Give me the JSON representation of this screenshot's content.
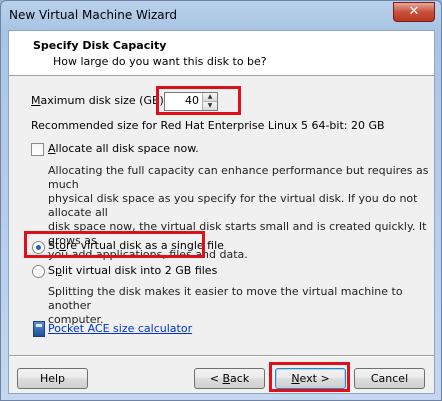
{
  "window": {
    "title": "New Virtual Machine Wizard",
    "close_glyph": "✕"
  },
  "header": {
    "title": "Specify Disk Capacity",
    "subtitle": "How large do you want this disk to be?"
  },
  "disk_size": {
    "label_prefix": "M",
    "label_rest": "aximum disk size (GB):",
    "value": "40",
    "spin_up": "▲",
    "spin_down": "▼",
    "recommended": "Recommended size for Red Hat Enterprise Linux 5 64-bit: 20 GB"
  },
  "allocate": {
    "label_prefix": "A",
    "label_rest": "llocate all disk space now.",
    "checked": false,
    "description_lines": [
      "Allocating the full capacity can enhance performance but requires as much",
      "physical disk space as you specify for the virtual disk. If you do not allocate all",
      "disk space now, the virtual disk starts small and is created quickly. It grows as",
      "you add applications, files and data."
    ]
  },
  "store_options": {
    "single": {
      "label_a": "St",
      "label_u": "o",
      "label_b": "re virtual disk as a single file",
      "selected": true
    },
    "split": {
      "label_a": "S",
      "label_u": "p",
      "label_b": "lit virtual disk into 2 GB files",
      "selected": false
    },
    "split_description_lines": [
      "Splitting the disk makes it easier to move the virtual machine to another",
      "computer."
    ]
  },
  "calculator_link": "Pocket ACE size calculator",
  "buttons": {
    "help": "Help",
    "back_prefix": "< ",
    "back_u": "B",
    "back_rest": "ack",
    "next_u": "N",
    "next_rest": "ext >",
    "cancel": "Cancel"
  },
  "colors": {
    "highlight": "#e0101a",
    "link": "#0033cc",
    "radio_dot": "#2a5fc0"
  }
}
